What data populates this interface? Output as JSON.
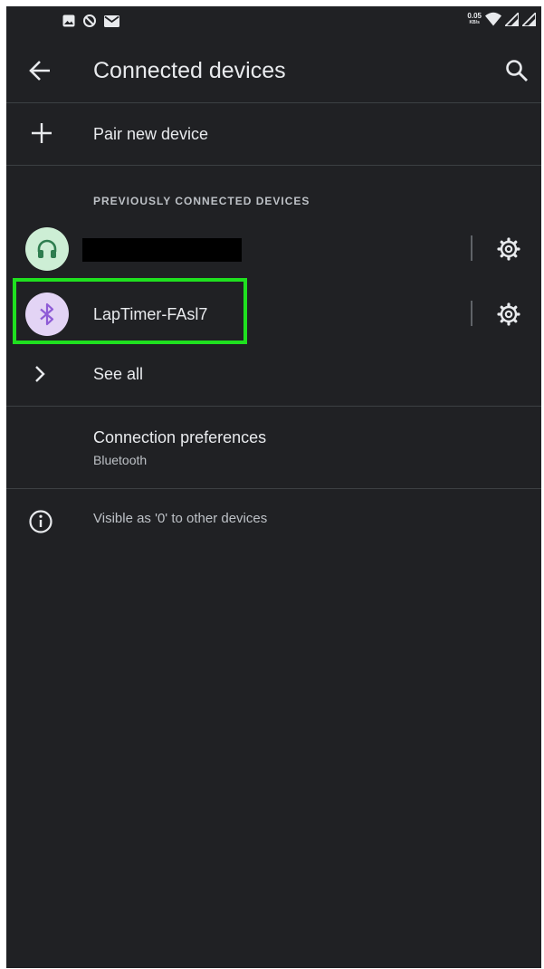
{
  "status_bar": {
    "left_icons": [
      "image-icon",
      "sync-disabled-icon",
      "mail-icon"
    ],
    "net_speed_value": "0.05",
    "net_speed_unit": "KB/s",
    "right_icons": [
      "wifi-icon",
      "signal-icon",
      "signal-icon"
    ]
  },
  "app_bar": {
    "title": "Connected devices",
    "back_icon": "arrow-back-icon",
    "search_icon": "search-icon"
  },
  "pair": {
    "label": "Pair new device",
    "icon": "plus-icon"
  },
  "section": {
    "header": "PREVIOUSLY CONNECTED DEVICES"
  },
  "devices": [
    {
      "name": "",
      "icon": "headphones-icon",
      "settings_icon": "gear-icon"
    },
    {
      "name": "LapTimer-FAsl7",
      "icon": "bluetooth-icon",
      "settings_icon": "gear-icon"
    }
  ],
  "see_all": {
    "label": "See all",
    "icon": "chevron-right-icon"
  },
  "prefs": {
    "label": "Connection preferences",
    "sublabel": "Bluetooth"
  },
  "info": {
    "label": "Visible as '0' to other devices",
    "icon": "info-icon"
  },
  "colors": {
    "background": "#202124",
    "text_primary": "#e8eaed",
    "text_secondary": "#bdc1c6",
    "highlight": "#1fe01f",
    "headphones_bg": "#cdeed5",
    "bluetooth_bg": "#e3d4f5"
  }
}
